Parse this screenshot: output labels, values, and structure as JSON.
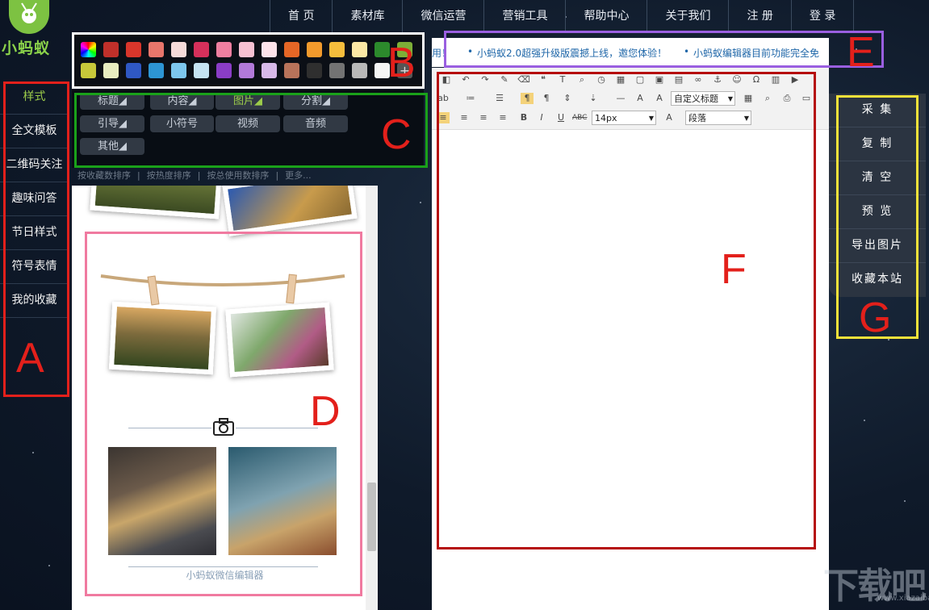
{
  "app": {
    "logo_text": "小蚂蚁",
    "accent_color": "#7dc242"
  },
  "nav": {
    "items": [
      "首 页",
      "素材库",
      "微信运营",
      "营销工具",
      "帮助中心",
      "关于我们",
      "注 册",
      "登 录"
    ]
  },
  "sidebar": {
    "items": [
      "样式",
      "全文模板",
      "二维码关注",
      "趣味问答",
      "节日样式",
      "符号表情",
      "我的收藏"
    ],
    "active_index": 0
  },
  "palette": {
    "colors_row1": [
      "rainbow",
      "#c0302a",
      "#d9362b",
      "#e8766b",
      "#f6dbd9",
      "#d6305b",
      "#ee7fa0",
      "#f6c1d2",
      "#fde3ea",
      "#e56626",
      "#f29a2c",
      "#f5bd3c",
      "#fbe7a4",
      "#2c8a2c",
      "#7dae37"
    ],
    "colors_row2": [
      "#c7c83a",
      "#e7ecc0",
      "#2f58c4",
      "#2d95d3",
      "#7dc7ee",
      "#c5e3f2",
      "#8a3dc6",
      "#b27ad9",
      "#d7b9e8",
      "#b8735a",
      "#2f2f2f",
      "#737373",
      "#b8b8b8",
      "#f5f5f5",
      "plus"
    ]
  },
  "categories": {
    "row1": [
      "标题◢",
      "内容◢",
      "图片◢",
      "分割◢"
    ],
    "row2": [
      "引导◢",
      "小符号",
      "视频",
      "音频"
    ],
    "row3": [
      "其他◢"
    ],
    "active": "图片◢",
    "sort_links": [
      "按收藏数排序",
      "|",
      "按热度排序",
      "|",
      "按总使用数排序",
      "|",
      "更多..."
    ]
  },
  "preview": {
    "footer_text": "小蚂蚁微信编辑器",
    "camera_icon": "camera-icon"
  },
  "announcement": {
    "prefix": "用！",
    "items": [
      "小蚂蚁2.0超强升级版震撼上线，邀您体验！",
      "小蚂蚁编辑器目前功能完全免"
    ]
  },
  "editor": {
    "style_select": "自定义标题",
    "font_size": "14px",
    "paragraph_select": "段落"
  },
  "tools": {
    "items": [
      "采 集",
      "复 制",
      "清 空",
      "预 览",
      "导出图片",
      "收藏本站"
    ]
  },
  "annotations": {
    "labels": [
      "A",
      "B",
      "C",
      "D",
      "E",
      "F",
      "G"
    ],
    "colors": {
      "A": "#e3201b",
      "B": "#ffffff",
      "C": "#1aa11a",
      "D": "#f07aa0",
      "E": "#9a5fe0",
      "F": "#b50d0d",
      "G": "#f5e23a"
    }
  },
  "watermark": {
    "text": "下载吧",
    "url": "www.xiazaiba.com"
  }
}
